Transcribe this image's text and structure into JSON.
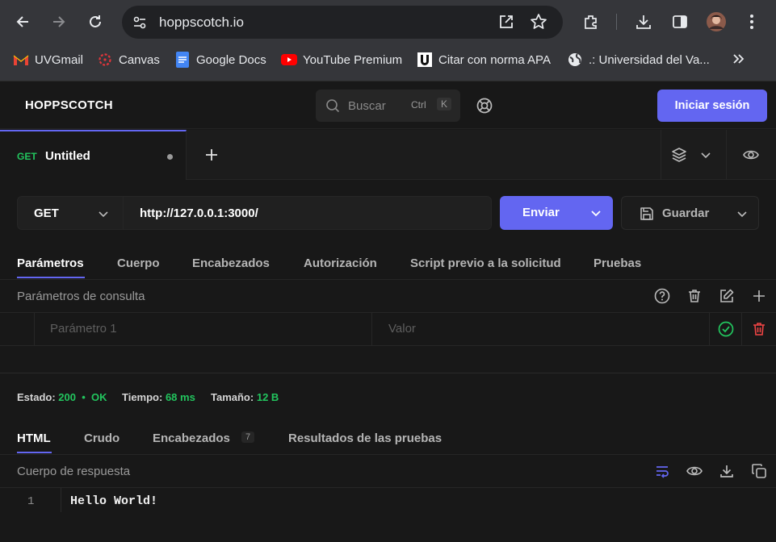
{
  "browser": {
    "url": "hoppscotch.io",
    "bookmarks": [
      {
        "label": "UVGmail",
        "icon": "gmail-icon"
      },
      {
        "label": "Canvas",
        "icon": "canvas-icon"
      },
      {
        "label": "Google Docs",
        "icon": "docs-icon"
      },
      {
        "label": "YouTube Premium",
        "icon": "youtube-icon"
      },
      {
        "label": "Citar con norma APA",
        "icon": "apa-icon"
      },
      {
        "label": ".: Universidad del Va...",
        "icon": "globe-icon"
      }
    ]
  },
  "header": {
    "brand": "HOPPSCOTCH",
    "search_placeholder": "Buscar",
    "kbd_ctrl": "Ctrl",
    "kbd_k": "K",
    "login_label": "Iniciar sesión"
  },
  "tab": {
    "method": "GET",
    "title": "Untitled"
  },
  "request": {
    "method": "GET",
    "url": "http://127.0.0.1:3000/",
    "send_label": "Enviar",
    "save_label": "Guardar"
  },
  "request_tabs": [
    "Parámetros",
    "Cuerpo",
    "Encabezados",
    "Autorización",
    "Script previo a la solicitud",
    "Pruebas"
  ],
  "params": {
    "section_label": "Parámetros de consulta",
    "key_placeholder": "Parámetro 1",
    "value_placeholder": "Valor"
  },
  "response_meta": {
    "status_label": "Estado:",
    "status_value": "200  •  OK",
    "time_label": "Tiempo:",
    "time_value": "68 ms",
    "size_label": "Tamaño:",
    "size_value": "12 B"
  },
  "response_tabs": {
    "html": "HTML",
    "raw": "Crudo",
    "headers": "Encabezados",
    "headers_count": "7",
    "test_results": "Resultados de las pruebas"
  },
  "response_body": {
    "section_label": "Cuerpo de respuesta",
    "line_number": "1",
    "content": "Hello World!"
  },
  "colors": {
    "accent": "#6366f1",
    "success": "#22c55e",
    "danger": "#ef4444"
  }
}
